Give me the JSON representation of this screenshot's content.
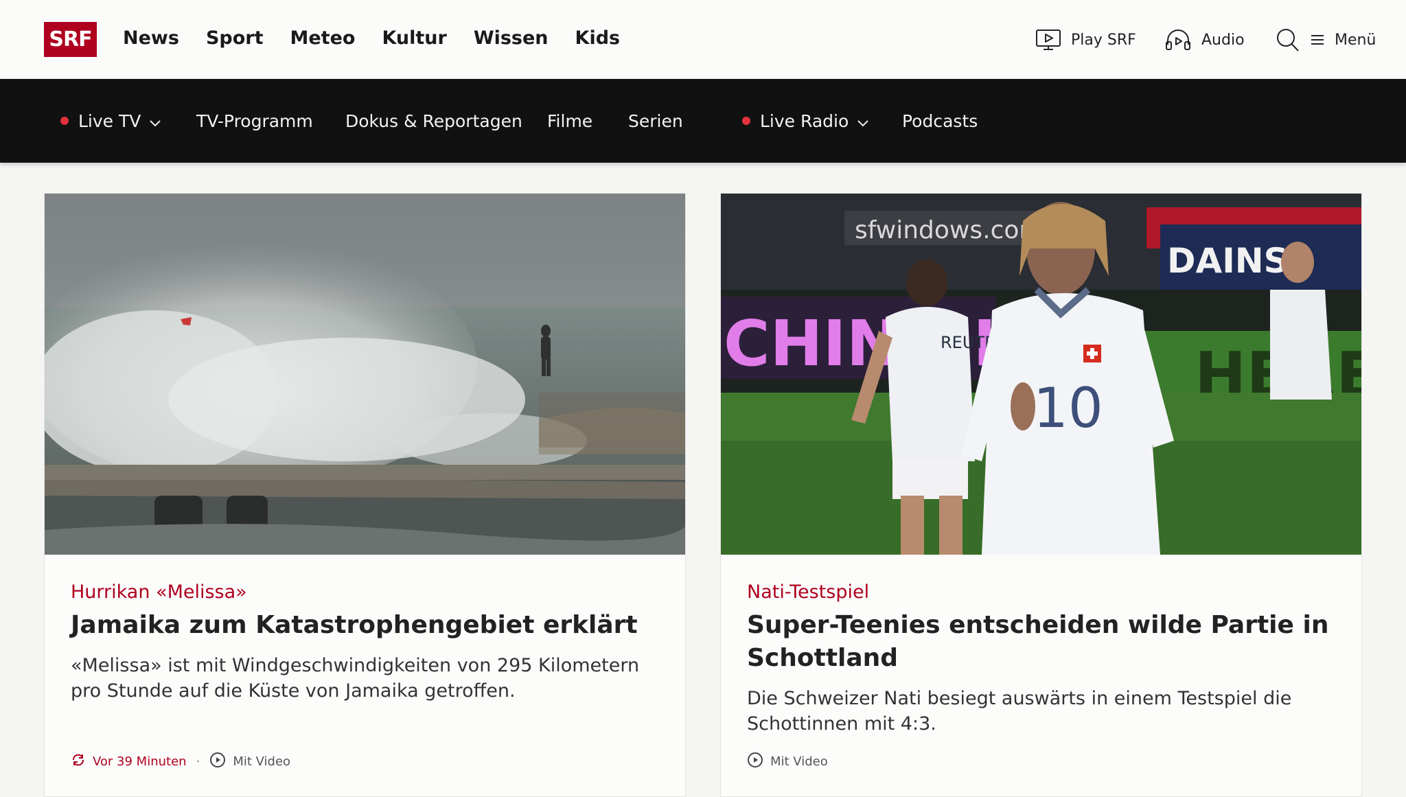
{
  "header": {
    "logo_text": "SRF",
    "nav": [
      "News",
      "Sport",
      "Meteo",
      "Kultur",
      "Wissen",
      "Kids"
    ],
    "play_label": "Play SRF",
    "audio_label": "Audio",
    "menu_label": "Menü"
  },
  "subnav": {
    "live_tv": "Live TV",
    "tv_programm": "TV-Programm",
    "dokus": "Dokus & Reportagen",
    "filme": "Filme",
    "serien": "Serien",
    "live_radio": "Live Radio",
    "podcasts": "Podcasts"
  },
  "cards": [
    {
      "kicker": "Hurrikan «Melissa»",
      "headline": "Jamaika zum Katastrophengebiet erklärt",
      "lead": "«Melissa» ist mit Windgeschwindigkeiten von 295 Kilometern pro Stunde auf die Küste von Jamaika getroffen.",
      "time": "Vor 39 Minuten",
      "video": "Mit Video"
    },
    {
      "kicker": "Nati-Testspiel",
      "headline": "Super-Teenies entscheiden wilde Partie in Schottland",
      "lead": "Die Schweizer Nati besiegt auswärts in einem Testspiel die Schottinnen mit 4:3.",
      "video": "Mit Video",
      "photo_texts": [
        "sfwindows.com",
        "DAINS",
        "CHING I",
        "HERE R",
        "REUTE",
        "10"
      ]
    }
  ],
  "colors": {
    "brand_red": "#af001e",
    "live_dot": "#e2323d",
    "subnav_bg": "#111111"
  }
}
